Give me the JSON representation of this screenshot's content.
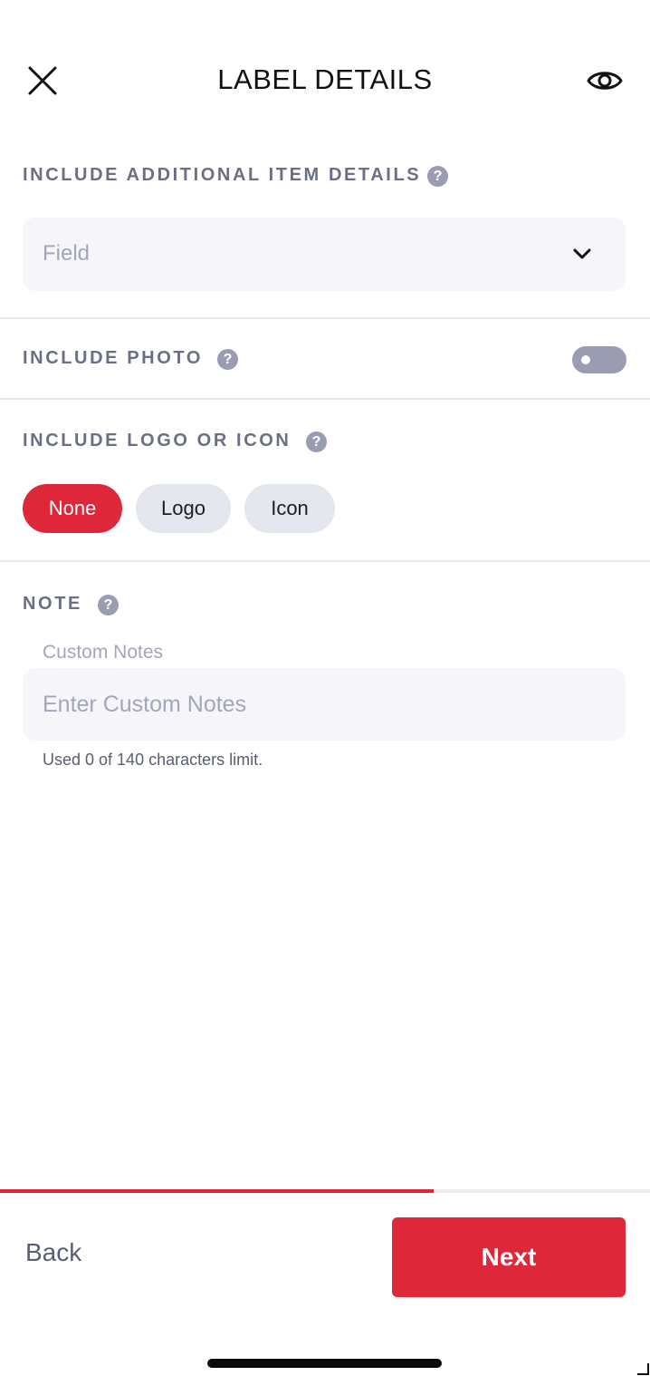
{
  "header": {
    "title": "LABEL DETAILS",
    "close_icon": "close-icon",
    "preview_icon": "eye-icon"
  },
  "sections": {
    "additional_details": {
      "label": "INCLUDE ADDITIONAL ITEM DETAILS",
      "help": "?",
      "select_placeholder": "Field"
    },
    "photo": {
      "label": "INCLUDE PHOTO",
      "help": "?",
      "toggle_on": false
    },
    "logo_icon": {
      "label": "INCLUDE LOGO OR ICON",
      "help": "?",
      "options": [
        "None",
        "Logo",
        "Icon"
      ],
      "selected": "None"
    },
    "note": {
      "label": "NOTE",
      "help": "?",
      "field_label": "Custom Notes",
      "placeholder": "Enter Custom Notes",
      "value": "",
      "char_count": "Used 0 of 140 characters limit."
    }
  },
  "progress": {
    "fraction": 0.667
  },
  "footer": {
    "back_label": "Back",
    "next_label": "Next"
  },
  "colors": {
    "accent": "#de2739",
    "label": "#6b6f86",
    "muted": "#a3a6bb",
    "field_bg": "#f6f6fa",
    "pill_bg": "#e5e7ee"
  }
}
